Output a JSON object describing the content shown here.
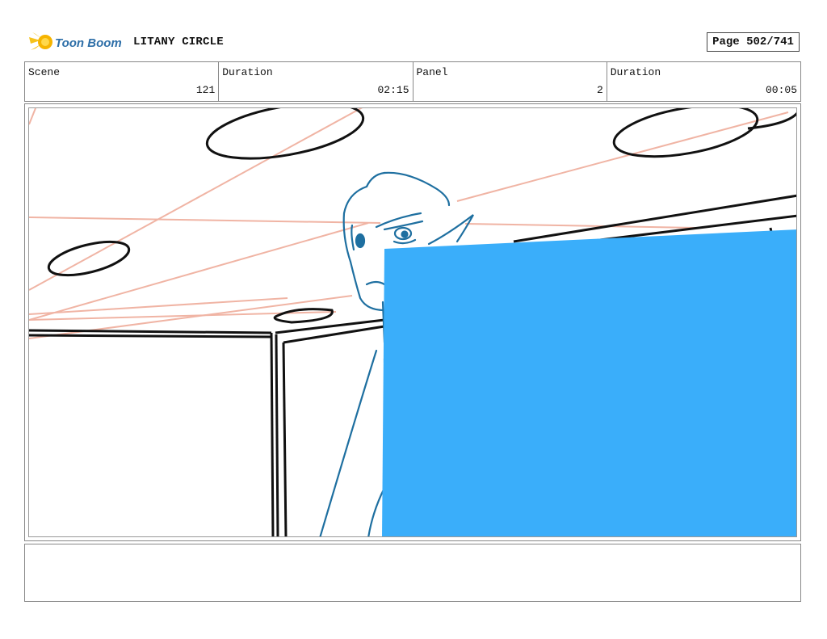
{
  "header": {
    "logo_text": "Toon Boom",
    "project_title": "LITANY CIRCLE",
    "page_label": "Page 502/741"
  },
  "info": {
    "scene_label": "Scene",
    "scene_value": "121",
    "scene_duration_label": "Duration",
    "scene_duration_value": "02:15",
    "panel_label": "Panel",
    "panel_value": "2",
    "panel_duration_label": "Duration",
    "panel_duration_value": "00:05"
  },
  "colors": {
    "ink": "#111111",
    "character_line": "#1e6fa0",
    "guide_line": "#f0b4a4",
    "overlay_fill": "#3aaefa"
  },
  "notes": {
    "text": ""
  }
}
